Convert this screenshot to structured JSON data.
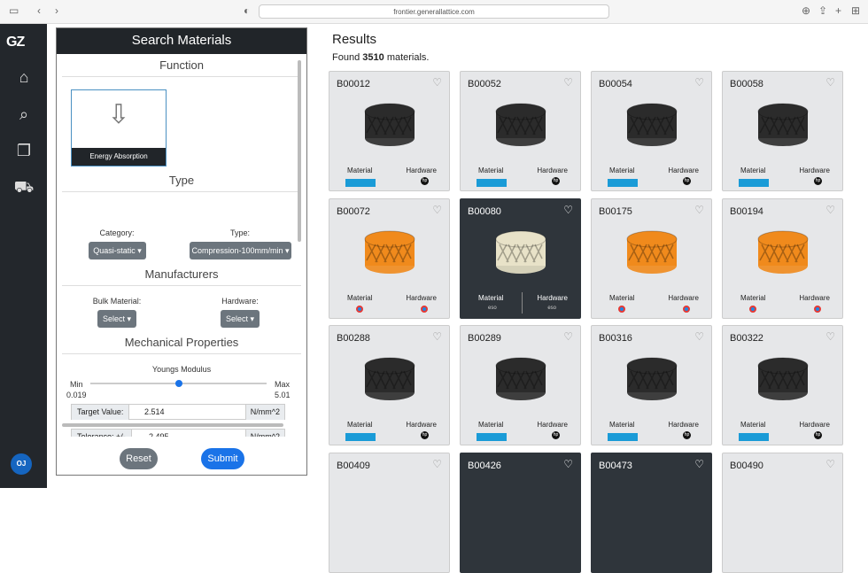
{
  "browser": {
    "url": "frontier.generallattice.com"
  },
  "sidebar": {
    "logo": "GZ",
    "user_initials": "OJ"
  },
  "panel": {
    "title": "Search Materials",
    "function_header": "Function",
    "function_card": "Energy Absorption",
    "type_header": "Type",
    "category_label": "Category:",
    "category_value": "Quasi-static",
    "type_label": "Type:",
    "type_value": "Compression-100mm/min",
    "manufacturers_header": "Manufacturers",
    "bulk_label": "Bulk Material:",
    "bulk_value": "Select",
    "hardware_label": "Hardware:",
    "hardware_value": "Select",
    "mech_header": "Mechanical Properties",
    "youngs_label": "Youngs Modulus",
    "min_label": "Min",
    "min_value": "0.019",
    "max_label": "Max",
    "max_value": "5.01",
    "slider_fraction": 0.5,
    "target_label": "Target Value:",
    "target_value": "2.514",
    "target_unit": "N/mm^2",
    "tol_label": "Tolerance: +/-",
    "tol_value": "2.495",
    "tol_unit": "N/mm^2",
    "reset": "Reset",
    "submit": "Submit"
  },
  "results": {
    "title": "Results",
    "found_prefix": "Found",
    "count": "3510",
    "found_suffix": "materials.",
    "material_label": "Material",
    "hardware_label": "Hardware",
    "cards": [
      {
        "id": "B00012",
        "style": "black"
      },
      {
        "id": "B00052",
        "style": "black"
      },
      {
        "id": "B00054",
        "style": "black"
      },
      {
        "id": "B00058",
        "style": "black"
      },
      {
        "id": "B00072",
        "style": "orange"
      },
      {
        "id": "B00080",
        "style": "white"
      },
      {
        "id": "B00175",
        "style": "orange"
      },
      {
        "id": "B00194",
        "style": "orange"
      },
      {
        "id": "B00288",
        "style": "black"
      },
      {
        "id": "B00289",
        "style": "black"
      },
      {
        "id": "B00316",
        "style": "black"
      },
      {
        "id": "B00322",
        "style": "black"
      },
      {
        "id": "B00409",
        "style": "light"
      },
      {
        "id": "B00426",
        "style": "dark"
      },
      {
        "id": "B00473",
        "style": "dark"
      },
      {
        "id": "B00490",
        "style": "light"
      }
    ]
  },
  "colors": {
    "accent": "#1a73e8",
    "rail": "#23272c",
    "orange": "#f08a1c"
  }
}
